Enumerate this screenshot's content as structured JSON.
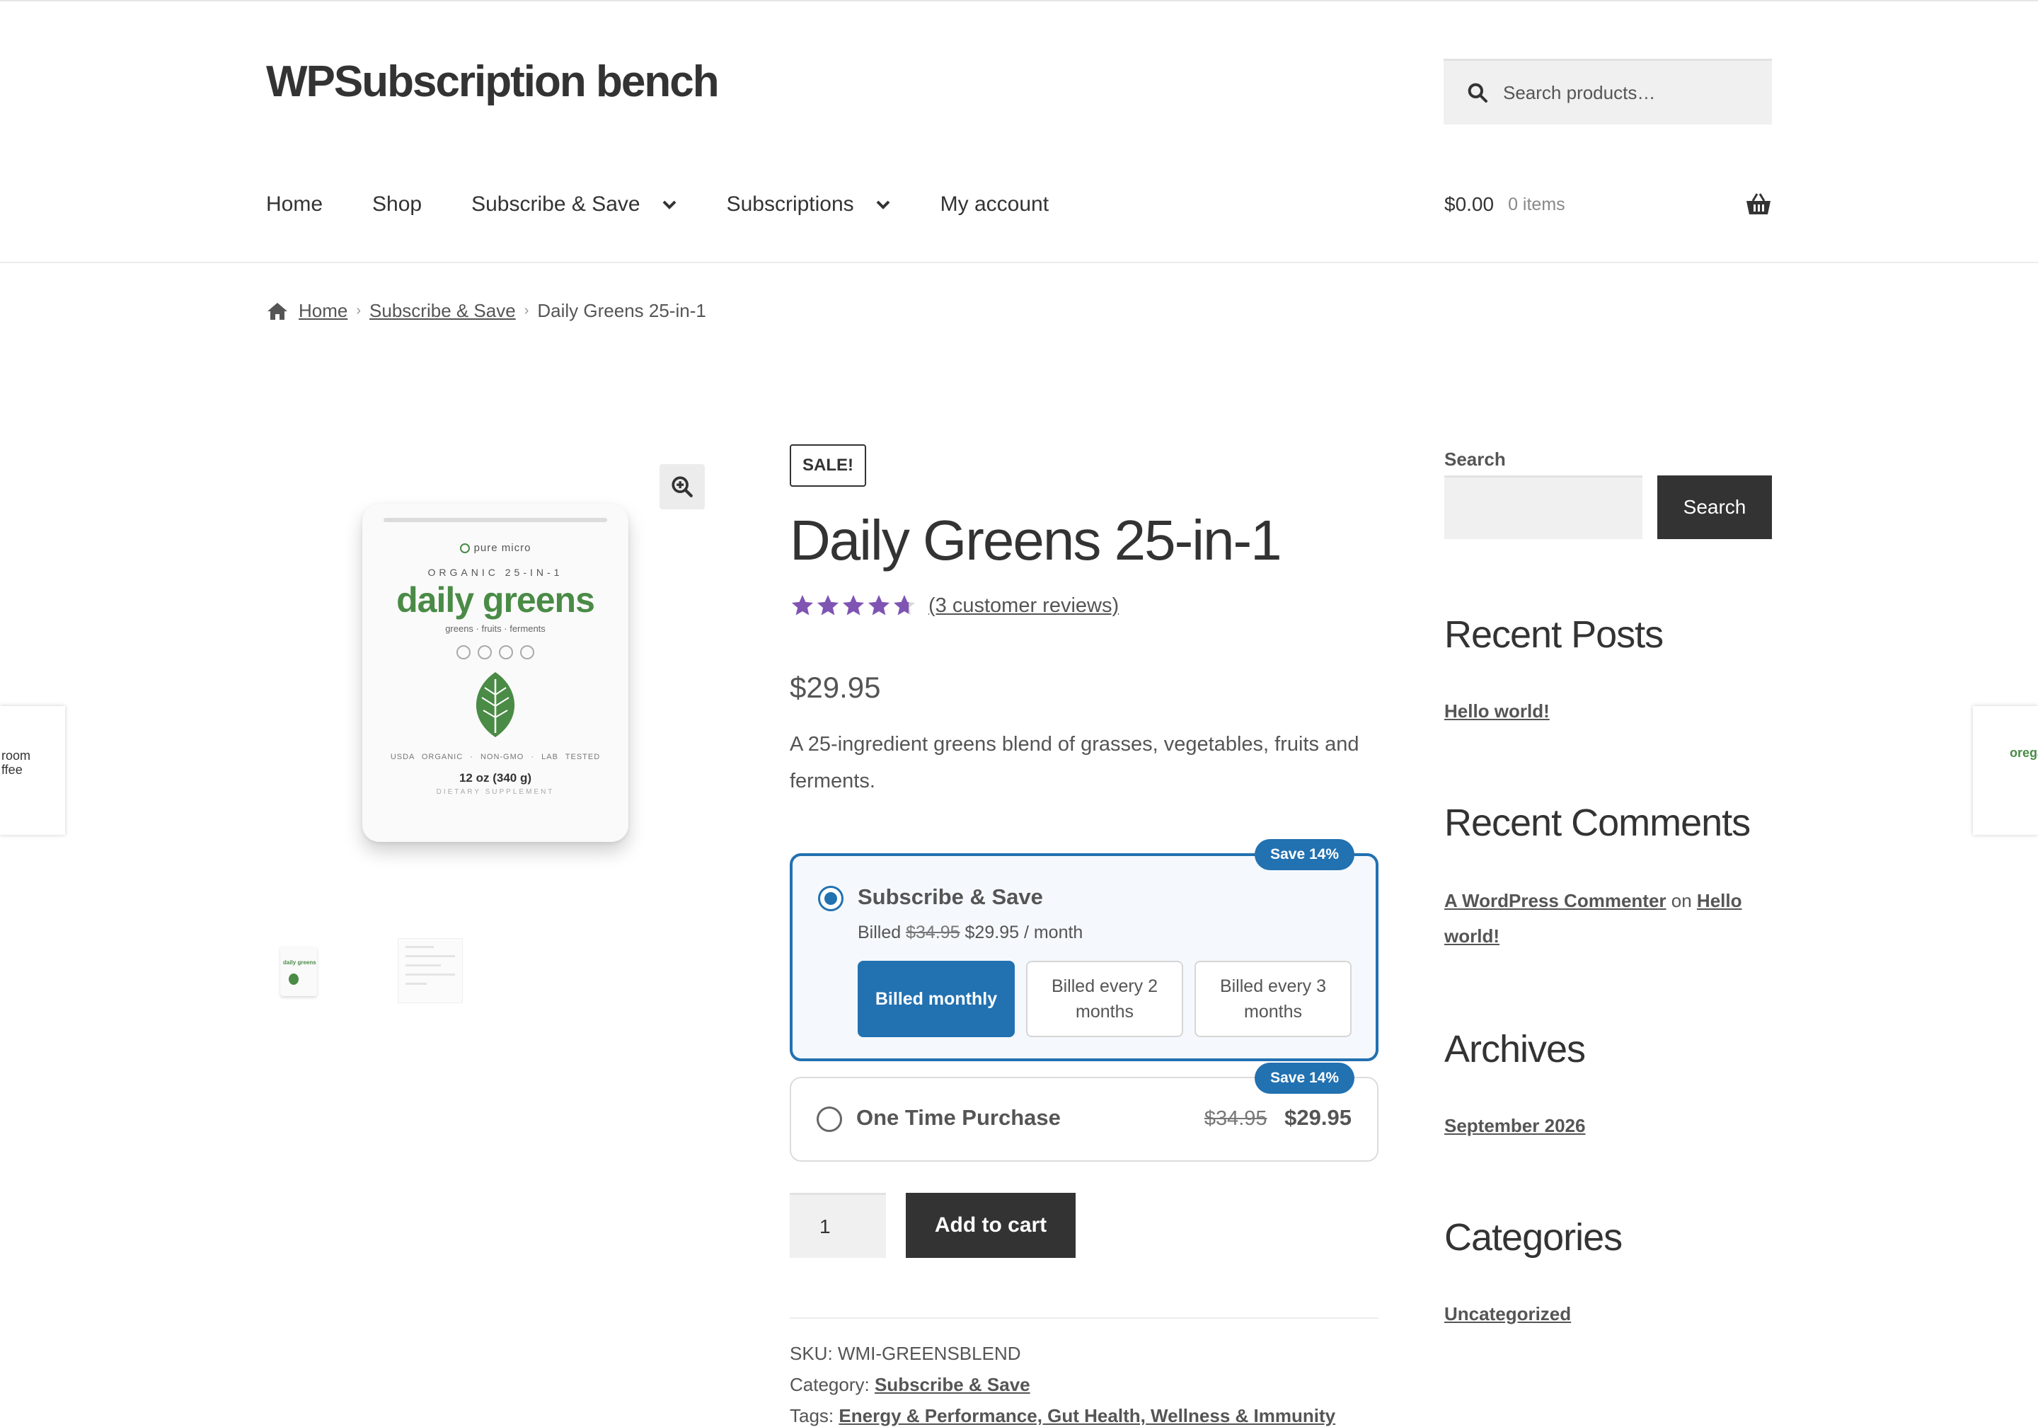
{
  "site": {
    "title": "WPSubscription bench"
  },
  "header_search": {
    "placeholder": "Search products…"
  },
  "nav": [
    {
      "label": "Home"
    },
    {
      "label": "Shop"
    },
    {
      "label": "Subscribe & Save"
    },
    {
      "label": "Subscriptions"
    },
    {
      "label": "My account"
    }
  ],
  "cart": {
    "amount": "$0.00",
    "items": "0 items"
  },
  "breadcrumb": {
    "home": "Home",
    "category": "Subscribe & Save",
    "current": "Daily Greens 25-in-1"
  },
  "product_image": {
    "brand": "pure micro",
    "line": "ORGANIC 25-IN-1",
    "name": "daily greens",
    "sub": "greens · fruits · ferments",
    "badges": "USDA ORGANIC · NON-GMO · LAB TESTED",
    "weight": "12 oz (340 g)",
    "supplement": "DIETARY SUPPLEMENT"
  },
  "neighbors": {
    "left_text": "room\nffee",
    "right_text": "orega"
  },
  "thumbs": {
    "first_text": "daily greens"
  },
  "product": {
    "sale_badge": "SALE!",
    "title": "Daily Greens 25-in-1",
    "rating": 4.67,
    "reviews_link": "(3 customer reviews)",
    "price": "$29.95",
    "description": "A 25-ingredient greens blend of grasses, vegetables, fruits and ferments."
  },
  "subscribe_option": {
    "badge": "Save 14%",
    "title": "Subscribe & Save",
    "billed_prefix": "Billed",
    "old_price": "$34.95",
    "new_price": "$29.95 / month",
    "frequencies": [
      {
        "label": "Billed monthly",
        "active": true
      },
      {
        "label": "Billed every 2 months",
        "active": false
      },
      {
        "label": "Billed every 3 months",
        "active": false
      }
    ]
  },
  "onetime_option": {
    "badge": "Save 14%",
    "title": "One Time Purchase",
    "old_price": "$34.95",
    "new_price": "$29.95"
  },
  "cart_form": {
    "quantity": "1",
    "add_to_cart": "Add to cart"
  },
  "meta": {
    "sku_label": "SKU:",
    "sku": "WMI-GREENSBLEND",
    "category_label": "Category:",
    "category": "Subscribe & Save",
    "tags_label": "Tags:",
    "tags": "Energy & Performance, Gut Health, Wellness & Immunity"
  },
  "sidebar": {
    "search_label": "Search",
    "search_button": "Search",
    "recent_posts_title": "Recent Posts",
    "recent_post": "Hello world!",
    "recent_comments_title": "Recent Comments",
    "comment_author": "A WordPress Commenter",
    "comment_on": "on",
    "comment_post": "Hello world!",
    "archives_title": "Archives",
    "archive": "September 2026",
    "categories_title": "Categories",
    "category": "Uncategorized"
  },
  "colors": {
    "accent": "#2271b1",
    "star": "#7f54b3",
    "leaf": "#4a8b46",
    "dark_button": "#333333"
  }
}
